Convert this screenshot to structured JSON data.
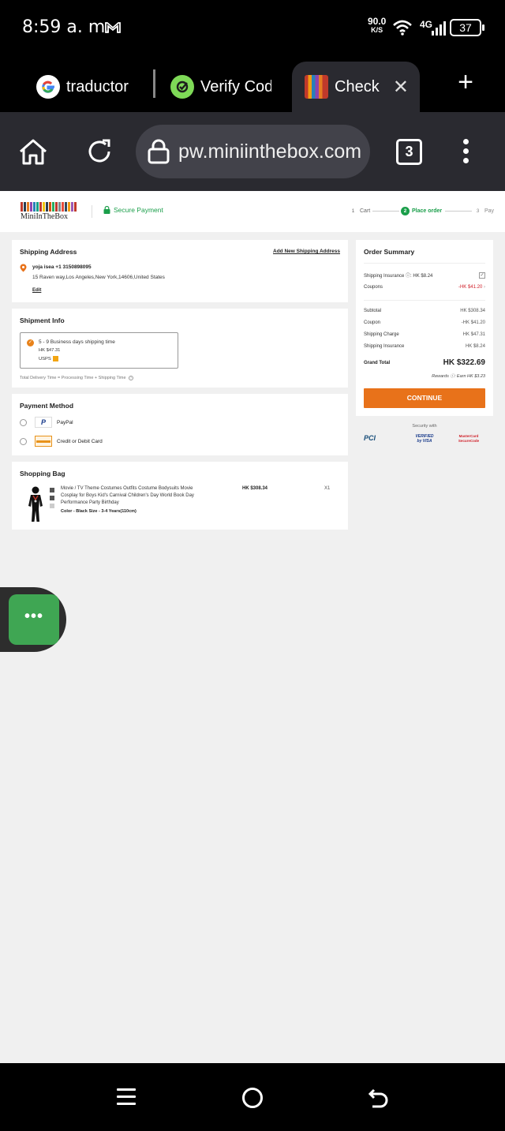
{
  "status_bar": {
    "time": "8:59 a. m.",
    "net_speed": "90.0",
    "net_speed_unit": "K/S",
    "network": "4G",
    "battery": "37"
  },
  "tabs": [
    {
      "label": "traductor",
      "icon": "google-icon"
    },
    {
      "label": "Verify Cod",
      "icon": "verify-app-icon"
    },
    {
      "label": "Check",
      "icon": "miniinthebox-favicon"
    }
  ],
  "toolbar": {
    "url": "pw.miniinthebox.com",
    "tab_count": "3"
  },
  "header": {
    "logo_text": "MiniInTheBox",
    "secure_label": "Secure Payment",
    "steps": [
      {
        "num": "1",
        "label": "Cart"
      },
      {
        "num": "2",
        "label": "Place order"
      },
      {
        "num": "3",
        "label": "Pay"
      }
    ]
  },
  "shipping_address": {
    "title": "Shipping Address",
    "add_link": "Add New Shipping Address",
    "name_phone": "yoja isea +1 3150898095",
    "address": "15 Raven way,Los Angeles,New York,14606,United States",
    "edit": "Edit"
  },
  "shipment_info": {
    "title": "Shipment Info",
    "option_time": "5 - 9 Business days shipping time",
    "option_price": "HK $47.31",
    "option_carrier": "USPS",
    "note": "Total Delivery Time = Processing Time + Shipping Time"
  },
  "payment": {
    "title": "Payment Method",
    "options": [
      {
        "label": "PayPal"
      },
      {
        "label": "Credit or Debit Card"
      }
    ]
  },
  "bag": {
    "title": "Shopping Bag",
    "item_name": "Movie / TV Theme Costumes Outfits Costume Bodysuits Movie Cosplay for Boys Kid's Carnival Children's Day World Book Day Performance Party Birthday",
    "variant": "Color - Black  Size - 3-4 Years(110cm)",
    "price": "HK $308.34",
    "qty": "X1"
  },
  "summary": {
    "title": "Order Summary",
    "insurance_label": "Shipping Insurance ⓘ: HK $8.24",
    "coupons_label": "Coupons",
    "coupons_value": "-HK $41.20",
    "rows": [
      {
        "label": "Subtotal",
        "value": "HK $308.34"
      },
      {
        "label": "Coupon",
        "value": "-HK $41.20"
      },
      {
        "label": "Shipping Charge",
        "value": "HK $47.31"
      },
      {
        "label": "Shipping Insurance",
        "value": "HK $8.24"
      }
    ],
    "grand_label": "Grand Total",
    "grand_value": "HK $322.69",
    "rewards": "Rewards ⓘ: Earn HK $3.23",
    "continue": "CONTINUE"
  },
  "security": {
    "label": "Security with",
    "badges": [
      "PCI",
      "VERIFIED by VISA",
      "MasterCard SecureCode"
    ]
  },
  "colors": {
    "accent": "#e8721a",
    "secure_green": "#1a9e4a",
    "coupon_red": "#d0202a",
    "chat_green": "#3fa653"
  }
}
